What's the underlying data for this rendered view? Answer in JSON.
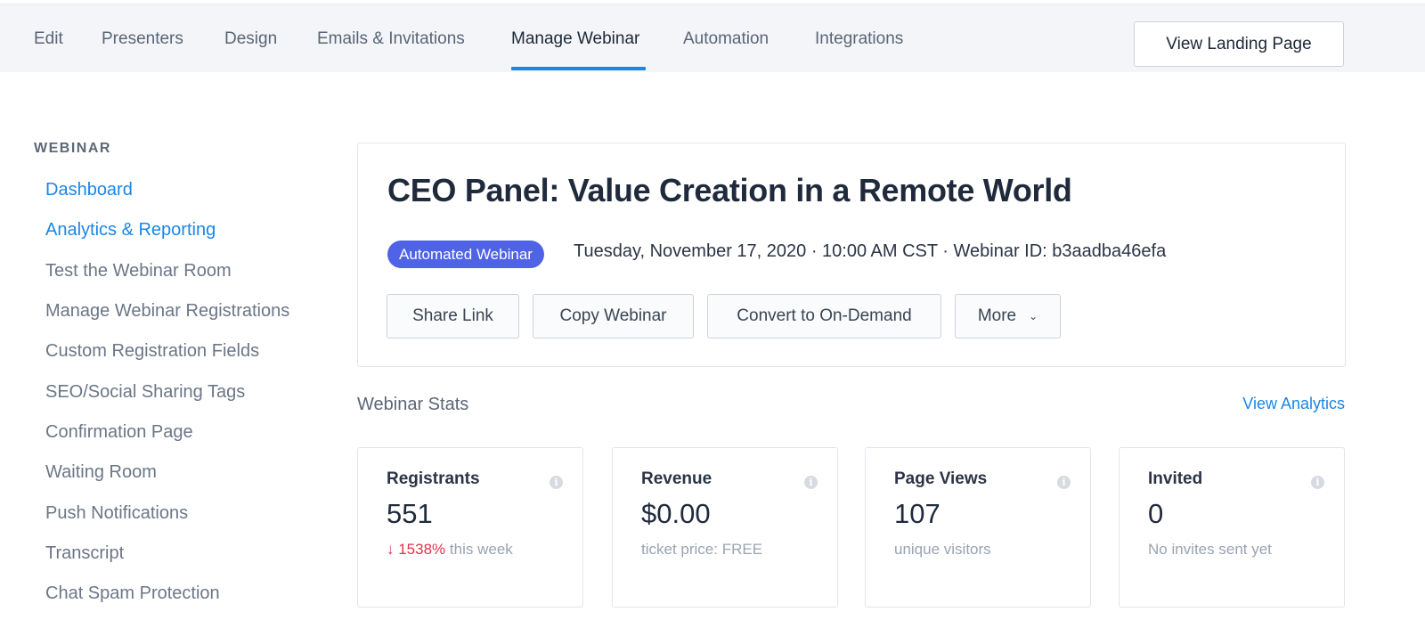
{
  "topnav": {
    "tabs": [
      "Edit",
      "Presenters",
      "Design",
      "Emails & Invitations",
      "Manage Webinar",
      "Automation",
      "Integrations"
    ],
    "active_tab": "Manage Webinar",
    "landing_button": "View Landing Page"
  },
  "sidebar": {
    "heading": "WEBINAR",
    "items": [
      {
        "label": "Dashboard"
      },
      {
        "label": "Analytics & Reporting"
      },
      {
        "label": "Test the Webinar Room"
      },
      {
        "label": "Manage Webinar Registrations"
      },
      {
        "label": "Custom Registration Fields"
      },
      {
        "label": "SEO/Social Sharing Tags"
      },
      {
        "label": "Confirmation Page"
      },
      {
        "label": "Waiting Room"
      },
      {
        "label": "Push Notifications"
      },
      {
        "label": "Transcript"
      },
      {
        "label": "Chat Spam Protection"
      }
    ]
  },
  "webinar": {
    "title": "CEO Panel: Value Creation in a Remote World",
    "badge": "Automated Webinar",
    "meta": "Tuesday, November 17, 2020 · 10:00 AM CST · Webinar ID: b3aadba46efa",
    "actions": {
      "share": "Share Link",
      "copy": "Copy Webinar",
      "convert": "Convert to On-Demand",
      "more": "More"
    }
  },
  "stats": {
    "title": "Webinar Stats",
    "view_analytics": "View Analytics",
    "cards": [
      {
        "label": "Registrants",
        "value": "551",
        "change": "↓ 1538%",
        "sub": "this week"
      },
      {
        "label": "Revenue",
        "value": "$0.00",
        "sub": "ticket price: FREE"
      },
      {
        "label": "Page Views",
        "value": "107",
        "sub": "unique visitors"
      },
      {
        "label": "Invited",
        "value": "0",
        "sub": "No invites sent yet"
      }
    ]
  },
  "colors": {
    "accent": "#1a86e6",
    "badge": "#4f63e6",
    "negative": "#e0334b"
  }
}
